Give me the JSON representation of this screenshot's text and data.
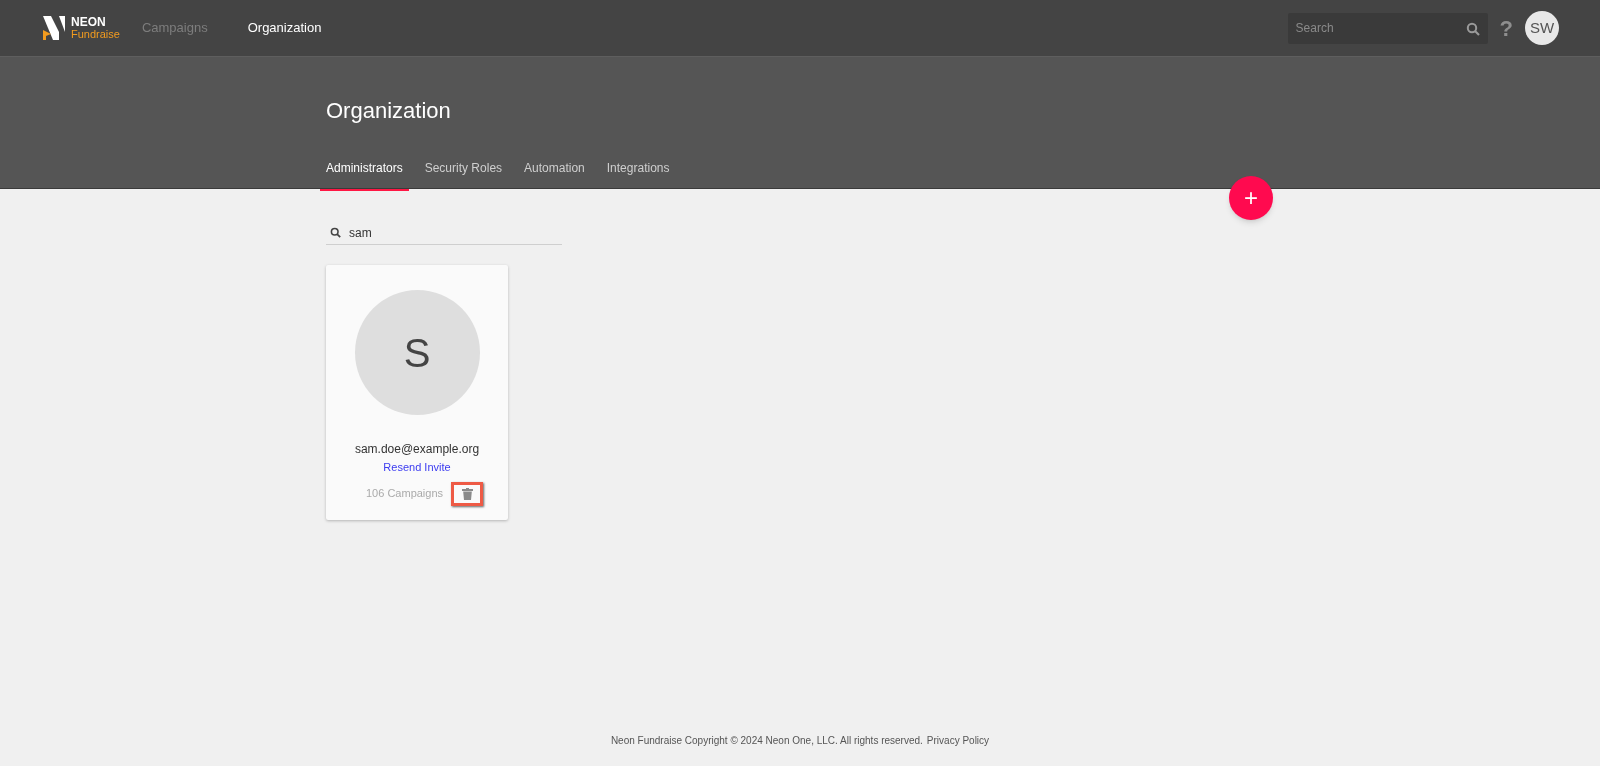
{
  "logo": {
    "top": "NEON",
    "bottom": "Fundraise"
  },
  "nav": [
    {
      "label": "Campaigns",
      "selected": false
    },
    {
      "label": "Organization",
      "selected": true
    }
  ],
  "global_search": {
    "placeholder": "Search"
  },
  "help": "?",
  "avatar": "SW",
  "page_title": "Organization",
  "tabs": [
    {
      "label": "Administrators",
      "selected": true
    },
    {
      "label": "Security Roles",
      "selected": false
    },
    {
      "label": "Automation",
      "selected": false
    },
    {
      "label": "Integrations",
      "selected": false
    }
  ],
  "add_button": "+",
  "filter": {
    "value": "sam"
  },
  "cards": [
    {
      "initial": "S",
      "email": "sam.doe@example.org",
      "action": "Resend Invite",
      "campaigns": "106 Campaigns",
      "delete_highlighted": true
    }
  ],
  "footer": {
    "text": "Neon Fundraise Copyright © 2024 Neon One, LLC. All rights reserved.",
    "link": "Privacy Policy"
  }
}
